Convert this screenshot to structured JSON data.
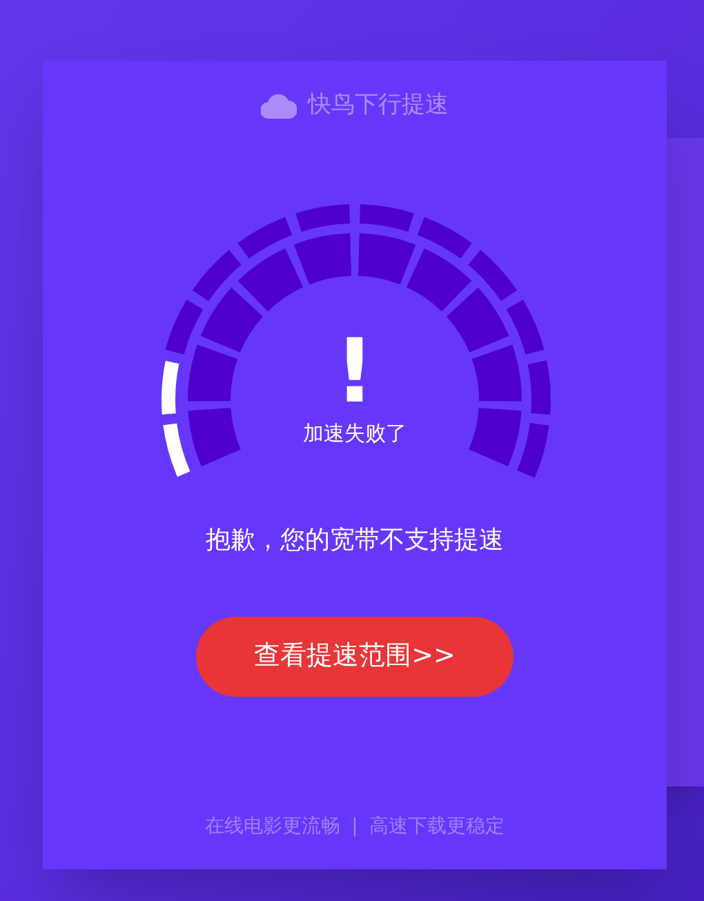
{
  "title": "快鸟下行提速",
  "gauge": {
    "outer_segments": [
      {
        "lit": true
      },
      {
        "lit": true
      },
      {
        "lit": false
      },
      {
        "lit": false
      },
      {
        "lit": false
      },
      {
        "lit": false
      },
      {
        "lit": false
      },
      {
        "lit": false
      },
      {
        "lit": false
      },
      {
        "lit": false
      },
      {
        "lit": false
      },
      {
        "lit": false
      }
    ],
    "symbol": "!",
    "status": "加速失败了"
  },
  "message": "抱歉，您的宽带不支持提速",
  "button": "查看提速范围>>",
  "footer": {
    "left": "在线电影更流畅",
    "separator": "|",
    "right": "高速下载更稳定"
  }
}
